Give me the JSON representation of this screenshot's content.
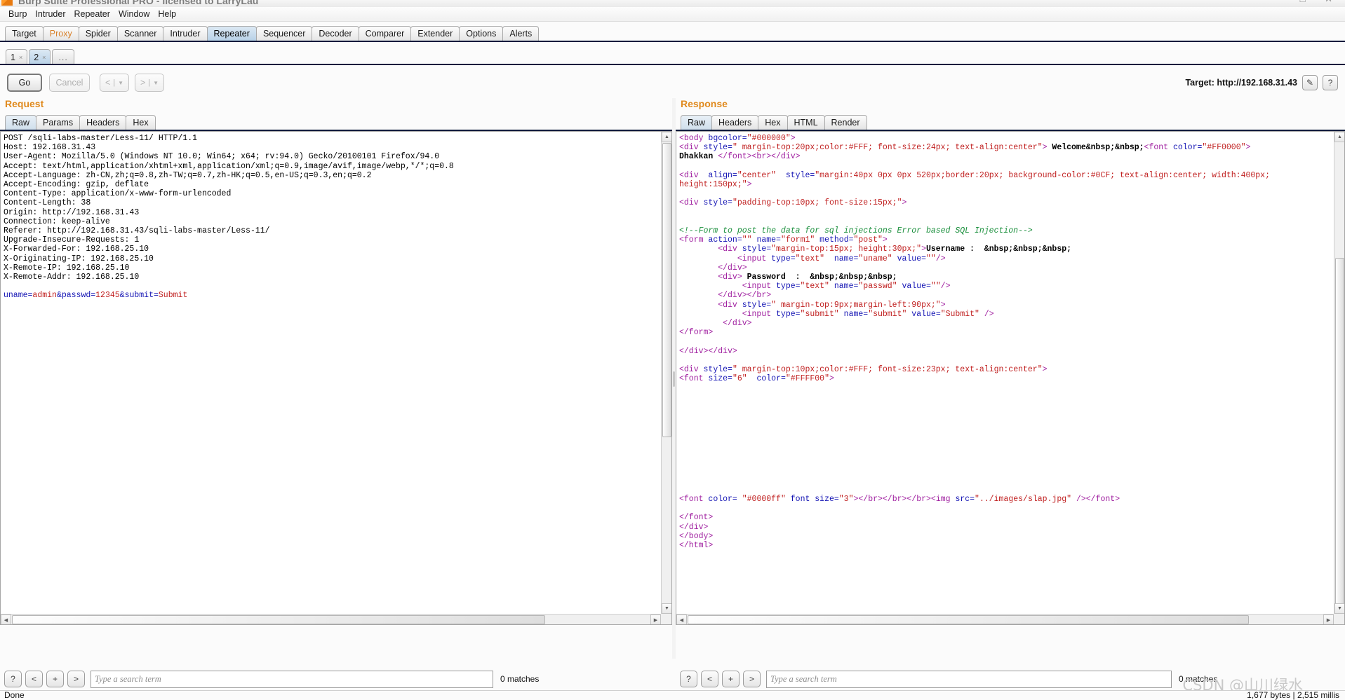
{
  "window": {
    "title": "Burp Suite Professional PRO - licensed to LarryLau",
    "minimize": "–",
    "maximize": "□",
    "close": "✕"
  },
  "menubar": [
    "Burp",
    "Intruder",
    "Repeater",
    "Window",
    "Help"
  ],
  "main_tabs": [
    {
      "label": "Target",
      "selected": false
    },
    {
      "label": "Proxy",
      "selected": false
    },
    {
      "label": "Spider",
      "selected": false
    },
    {
      "label": "Scanner",
      "selected": false
    },
    {
      "label": "Intruder",
      "selected": false
    },
    {
      "label": "Repeater",
      "selected": true
    },
    {
      "label": "Sequencer",
      "selected": false
    },
    {
      "label": "Decoder",
      "selected": false
    },
    {
      "label": "Comparer",
      "selected": false
    },
    {
      "label": "Extender",
      "selected": false
    },
    {
      "label": "Options",
      "selected": false
    },
    {
      "label": "Alerts",
      "selected": false
    }
  ],
  "repeater_tabs": [
    {
      "label": "1",
      "close": "×",
      "selected": false
    },
    {
      "label": "2",
      "close": "×",
      "selected": true
    }
  ],
  "repeater_add_tab": "...",
  "actions": {
    "go": "Go",
    "cancel": "Cancel",
    "back": "<",
    "forward": ">",
    "split": "|",
    "caret": "▼",
    "target_label": "Target: http://192.168.31.43",
    "edit_icon": "✎",
    "help_icon": "?"
  },
  "request": {
    "title": "Request",
    "tabs": [
      {
        "label": "Raw",
        "selected": true
      },
      {
        "label": "Params",
        "selected": false
      },
      {
        "label": "Headers",
        "selected": false
      },
      {
        "label": "Hex",
        "selected": false
      }
    ],
    "headers": [
      "POST /sqli-labs-master/Less-11/ HTTP/1.1",
      "Host: 192.168.31.43",
      "User-Agent: Mozilla/5.0 (Windows NT 10.0; Win64; x64; rv:94.0) Gecko/20100101 Firefox/94.0",
      "Accept: text/html,application/xhtml+xml,application/xml;q=0.9,image/avif,image/webp,*/*;q=0.8",
      "Accept-Language: zh-CN,zh;q=0.8,zh-TW;q=0.7,zh-HK;q=0.5,en-US;q=0.3,en;q=0.2",
      "Accept-Encoding: gzip, deflate",
      "Content-Type: application/x-www-form-urlencoded",
      "Content-Length: 38",
      "Origin: http://192.168.31.43",
      "Connection: keep-alive",
      "Referer: http://192.168.31.43/sqli-labs-master/Less-11/",
      "Upgrade-Insecure-Requests: 1",
      "X-Forwarded-For: 192.168.25.10",
      "X-Originating-IP: 192.168.25.10",
      "X-Remote-IP: 192.168.25.10",
      "X-Remote-Addr: 192.168.25.10"
    ],
    "body_params": [
      {
        "name": "uname",
        "sep": "=",
        "value": "admin"
      },
      {
        "name": "&passwd",
        "sep": "=",
        "value": "12345"
      },
      {
        "name": "&submit",
        "sep": "=",
        "value": "Submit"
      }
    ],
    "search_placeholder": "Type a search term",
    "matches": "0 matches",
    "search_buttons": [
      "?",
      "<",
      "+",
      ">"
    ]
  },
  "response": {
    "title": "Response",
    "tabs": [
      {
        "label": "Raw",
        "selected": true
      },
      {
        "label": "Headers",
        "selected": false
      },
      {
        "label": "Hex",
        "selected": false
      },
      {
        "label": "HTML",
        "selected": false
      },
      {
        "label": "Render",
        "selected": false
      }
    ],
    "lines": [
      [
        {
          "t": "tag",
          "s": "<body "
        },
        {
          "t": "attr",
          "s": "bgcolor="
        },
        {
          "t": "val",
          "s": "\"#000000\""
        },
        {
          "t": "tag",
          "s": ">"
        }
      ],
      [
        {
          "t": "tag",
          "s": "<div "
        },
        {
          "t": "attr",
          "s": "style="
        },
        {
          "t": "val",
          "s": "\" margin-top:20px;color:#FFF; font-size:24px; text-align:center\""
        },
        {
          "t": "tag",
          "s": "> "
        },
        {
          "t": "txt",
          "s": "Welcome&nbsp;&nbsp;"
        },
        {
          "t": "tag",
          "s": "<font "
        },
        {
          "t": "attr",
          "s": "color="
        },
        {
          "t": "val",
          "s": "\"#FF0000\""
        },
        {
          "t": "tag",
          "s": ">"
        }
      ],
      [
        {
          "t": "txt",
          "s": "Dhakkan "
        },
        {
          "t": "tag",
          "s": "</font><br></div>"
        }
      ],
      [],
      [
        {
          "t": "tag",
          "s": "<div  "
        },
        {
          "t": "attr",
          "s": "align="
        },
        {
          "t": "val",
          "s": "\"center\""
        },
        {
          "t": "attr",
          "s": "  style="
        },
        {
          "t": "val",
          "s": "\"margin:40px 0px 0px 520px;border:20px; background-color:#0CF; text-align:center; width:400px;"
        }
      ],
      [
        {
          "t": "val",
          "s": "height:150px;\""
        },
        {
          "t": "tag",
          "s": ">"
        }
      ],
      [],
      [
        {
          "t": "tag",
          "s": "<div "
        },
        {
          "t": "attr",
          "s": "style="
        },
        {
          "t": "val",
          "s": "\"padding-top:10px; font-size:15px;\""
        },
        {
          "t": "tag",
          "s": ">"
        }
      ],
      [],
      [],
      [
        {
          "t": "comment",
          "s": "<!--Form to post the data for sql injections Error based SQL Injection-->"
        }
      ],
      [
        {
          "t": "tag",
          "s": "<form "
        },
        {
          "t": "attr",
          "s": "action="
        },
        {
          "t": "val",
          "s": "\"\""
        },
        {
          "t": "attr",
          "s": " name="
        },
        {
          "t": "val",
          "s": "\"form1\""
        },
        {
          "t": "attr",
          "s": " method="
        },
        {
          "t": "val",
          "s": "\"post\""
        },
        {
          "t": "tag",
          "s": ">"
        }
      ],
      [
        {
          "t": "tag",
          "s": "        <div "
        },
        {
          "t": "attr",
          "s": "style="
        },
        {
          "t": "val",
          "s": "\"margin-top:15px; height:30px;\""
        },
        {
          "t": "tag",
          "s": ">"
        },
        {
          "t": "txt",
          "s": "Username :  &nbsp;&nbsp;&nbsp;"
        }
      ],
      [
        {
          "t": "tag",
          "s": "            <input "
        },
        {
          "t": "attr",
          "s": "type="
        },
        {
          "t": "val",
          "s": "\"text\""
        },
        {
          "t": "attr",
          "s": "  name="
        },
        {
          "t": "val",
          "s": "\"uname\""
        },
        {
          "t": "attr",
          "s": " value="
        },
        {
          "t": "val",
          "s": "\"\""
        },
        {
          "t": "tag",
          "s": "/>"
        }
      ],
      [
        {
          "t": "tag",
          "s": "        </div>"
        }
      ],
      [
        {
          "t": "tag",
          "s": "        <div> "
        },
        {
          "t": "txt",
          "s": "Password  :  &nbsp;&nbsp;&nbsp;"
        }
      ],
      [
        {
          "t": "tag",
          "s": "             <input "
        },
        {
          "t": "attr",
          "s": "type="
        },
        {
          "t": "val",
          "s": "\"text\""
        },
        {
          "t": "attr",
          "s": " name="
        },
        {
          "t": "val",
          "s": "\"passwd\""
        },
        {
          "t": "attr",
          "s": " value="
        },
        {
          "t": "val",
          "s": "\"\""
        },
        {
          "t": "tag",
          "s": "/>"
        }
      ],
      [
        {
          "t": "tag",
          "s": "        </div></br>"
        }
      ],
      [
        {
          "t": "tag",
          "s": "        <div "
        },
        {
          "t": "attr",
          "s": "style="
        },
        {
          "t": "val",
          "s": "\" margin-top:9px;margin-left:90px;\""
        },
        {
          "t": "tag",
          "s": ">"
        }
      ],
      [
        {
          "t": "tag",
          "s": "             <input "
        },
        {
          "t": "attr",
          "s": "type="
        },
        {
          "t": "val",
          "s": "\"submit\""
        },
        {
          "t": "attr",
          "s": " name="
        },
        {
          "t": "val",
          "s": "\"submit\""
        },
        {
          "t": "attr",
          "s": " value="
        },
        {
          "t": "val",
          "s": "\"Submit\""
        },
        {
          "t": "tag",
          "s": " />"
        }
      ],
      [
        {
          "t": "tag",
          "s": "         </div>"
        }
      ],
      [
        {
          "t": "tag",
          "s": "</form>"
        }
      ],
      [],
      [
        {
          "t": "tag",
          "s": "</div></div>"
        }
      ],
      [],
      [
        {
          "t": "tag",
          "s": "<div "
        },
        {
          "t": "attr",
          "s": "style="
        },
        {
          "t": "val",
          "s": "\" margin-top:10px;color:#FFF; font-size:23px; text-align:center\""
        },
        {
          "t": "tag",
          "s": ">"
        }
      ],
      [
        {
          "t": "tag",
          "s": "<font "
        },
        {
          "t": "attr",
          "s": "size="
        },
        {
          "t": "val",
          "s": "\"6\""
        },
        {
          "t": "attr",
          "s": "  color="
        },
        {
          "t": "val",
          "s": "\"#FFFF00\""
        },
        {
          "t": "tag",
          "s": ">"
        }
      ],
      [],
      [],
      [],
      [],
      [],
      [],
      [],
      [],
      [],
      [],
      [],
      [],
      [
        {
          "t": "tag",
          "s": "<font "
        },
        {
          "t": "attr",
          "s": "color= "
        },
        {
          "t": "val",
          "s": "\"#0000ff\""
        },
        {
          "t": "attr",
          "s": " font size="
        },
        {
          "t": "val",
          "s": "\"3\""
        },
        {
          "t": "tag",
          "s": "></br></br></br><img "
        },
        {
          "t": "attr",
          "s": "src="
        },
        {
          "t": "val",
          "s": "\"../images/slap.jpg\""
        },
        {
          "t": "tag",
          "s": " /></font>"
        }
      ],
      [],
      [
        {
          "t": "tag",
          "s": "</font>"
        }
      ],
      [
        {
          "t": "tag",
          "s": "</div>"
        }
      ],
      [
        {
          "t": "tag",
          "s": "</body>"
        }
      ],
      [
        {
          "t": "tag",
          "s": "</html>"
        }
      ]
    ],
    "search_placeholder": "Type a search term",
    "matches": "0 matches",
    "search_buttons": [
      "?",
      "<",
      "+",
      ">"
    ]
  },
  "statusbar": {
    "left": "Done",
    "right": "1,677 bytes | 2,515 millis"
  },
  "watermark": "CSDN @山川绿水",
  "colors": {
    "accent_orange": "#e08a1e",
    "tab_selected": "#b6d0e6",
    "tag_purple": "#a020a0",
    "attr_blue": "#1414b4",
    "value_red": "#c02020",
    "comment_green": "#1a8f3c",
    "rule_navy": "#0a1a3c"
  }
}
